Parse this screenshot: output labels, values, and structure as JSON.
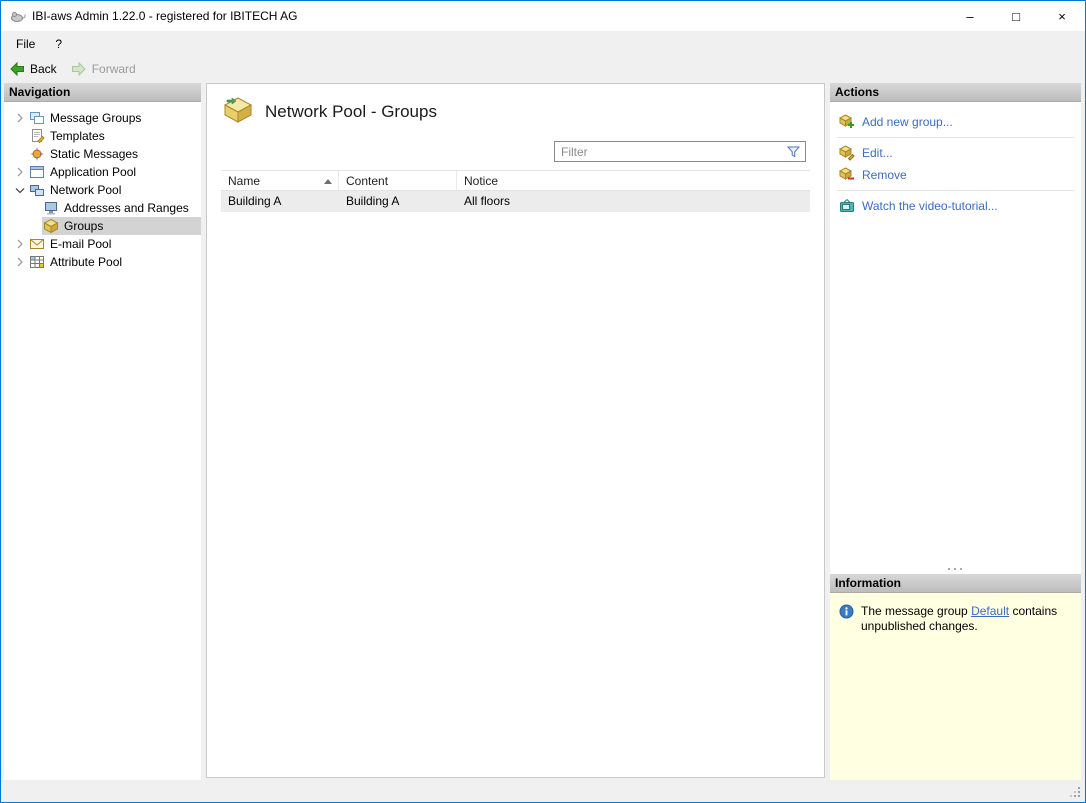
{
  "window": {
    "title": "IBI-aws Admin 1.22.0 - registered for IBITECH AG",
    "controls": {
      "minimize": "–",
      "maximize": "□",
      "close": "×"
    }
  },
  "menu": {
    "items": [
      {
        "label": "File"
      },
      {
        "label": "?"
      }
    ]
  },
  "toolbar": {
    "back_label": "Back",
    "forward_label": "Forward"
  },
  "navigation": {
    "header": "Navigation",
    "items": [
      {
        "label": "Message Groups"
      },
      {
        "label": "Templates"
      },
      {
        "label": "Static Messages"
      },
      {
        "label": "Application Pool"
      },
      {
        "label": "Network Pool"
      },
      {
        "label": "Addresses and Ranges"
      },
      {
        "label": "Groups"
      },
      {
        "label": "E-mail Pool"
      },
      {
        "label": "Attribute Pool"
      }
    ]
  },
  "main": {
    "title": "Network Pool - Groups",
    "filter_placeholder": "Filter",
    "table": {
      "columns": [
        "Name",
        "Content",
        "Notice"
      ],
      "rows": [
        {
          "name": "Building A",
          "content": "Building A",
          "notice": "All floors"
        }
      ]
    }
  },
  "actions": {
    "header": "Actions",
    "add": "Add new group...",
    "edit": "Edit...",
    "remove": "Remove",
    "tutorial": "Watch the video-tutorial..."
  },
  "information": {
    "header": "Information",
    "text_before": "The message group",
    "link_text": "Default",
    "text_after": "contains unpublished changes."
  },
  "colors": {
    "window_border": "#0078d7",
    "action_link": "#3b6cbf",
    "info_background": "#ffffe1",
    "selection_background": "#d3d3d3"
  }
}
